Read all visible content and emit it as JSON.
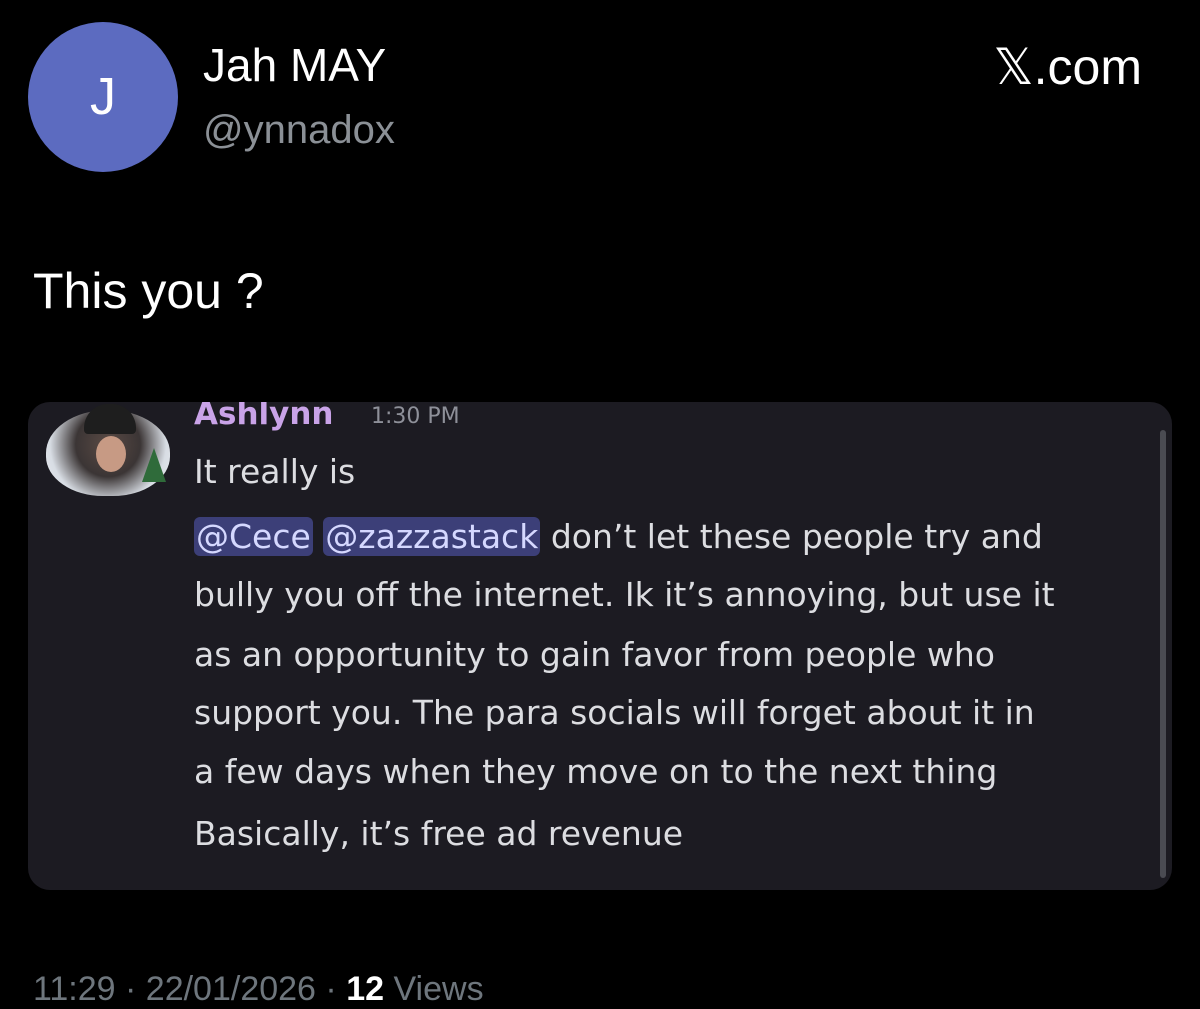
{
  "header": {
    "avatar_letter": "J",
    "display_name": "Jah MAY",
    "handle": "@ynnadox",
    "site": "𝕏.com"
  },
  "tweet": {
    "text": "This you ?"
  },
  "embed": {
    "author": "Ashlynn",
    "timestamp": "1:30 PM",
    "line1": "It really is",
    "mention1": "@Cece",
    "mention2": "@zazzastack",
    "line2_rest": "don’t let these people try and",
    "line3": "bully you off the internet. Ik it’s annoying, but use it",
    "line4": "as an opportunity to gain favor from people who",
    "line5": "support you. The para socials will forget about it in",
    "line6": "a few days when they move on to the next thing",
    "line7": "Basically, it’s free ad revenue"
  },
  "footer": {
    "time": "11:29",
    "date": "22/01/2026",
    "views_count": "12",
    "views_label": "Views"
  }
}
